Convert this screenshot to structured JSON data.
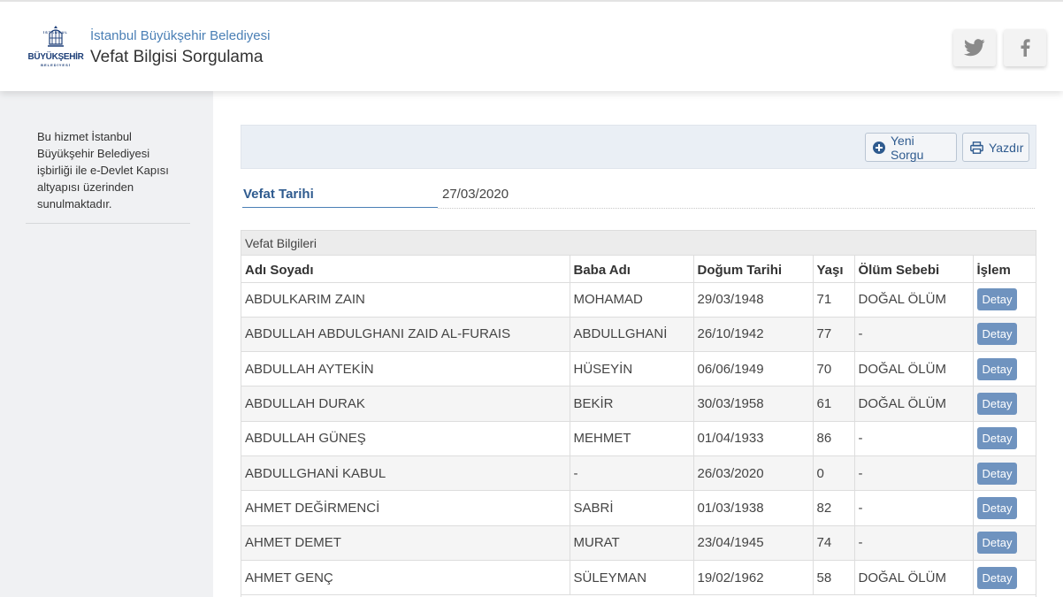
{
  "header": {
    "logo": {
      "top_text": "İSTANBUL",
      "main_text": "BÜYÜKŞEHİR",
      "sub_text": "BELEDİYESİ"
    },
    "organization": "İstanbul Büyükşehir Belediyesi",
    "title": "Vefat Bilgisi Sorgulama",
    "social": [
      {
        "icon": "twitter-icon"
      },
      {
        "icon": "facebook-icon"
      }
    ]
  },
  "sidebar": {
    "notice": "Bu hizmet İstanbul Büyükşehir Belediyesi işbirliği ile e-Devlet Kapısı altyapısı üzerinden sunulmaktadır."
  },
  "toolbar": {
    "new_query_label": "Yeni Sorgu",
    "new_query_icon": "plus-circle-icon",
    "print_label": "Yazdır",
    "print_icon": "printer-icon"
  },
  "filter": {
    "label": "Vefat Tarihi",
    "value": "27/03/2020"
  },
  "table": {
    "caption": "Vefat Bilgileri",
    "columns": [
      "Adı Soyadı",
      "Baba Adı",
      "Doğum Tarihi",
      "Yaşı",
      "Ölüm Sebebi",
      "İşlem"
    ],
    "action_label": "Detay",
    "rows": [
      {
        "name": "ABDULKARIM ZAIN",
        "father": "MOHAMAD",
        "birth": "29/03/1948",
        "age": "71",
        "cause": "DOĞAL ÖLÜM"
      },
      {
        "name": "ABDULLAH ABDULGHANI ZAID AL-FURAIS",
        "father": "ABDULLGHANİ",
        "birth": "26/10/1942",
        "age": "77",
        "cause": "-"
      },
      {
        "name": "ABDULLAH AYTEKİN",
        "father": "HÜSEYİN",
        "birth": "06/06/1949",
        "age": "70",
        "cause": "DOĞAL ÖLÜM"
      },
      {
        "name": "ABDULLAH DURAK",
        "father": "BEKİR",
        "birth": "30/03/1958",
        "age": "61",
        "cause": "DOĞAL ÖLÜM"
      },
      {
        "name": "ABDULLAH GÜNEŞ",
        "father": "MEHMET",
        "birth": "01/04/1933",
        "age": "86",
        "cause": "-"
      },
      {
        "name": "ABDULLGHANİ KABUL",
        "father": "-",
        "birth": "26/03/2020",
        "age": "0",
        "cause": "-"
      },
      {
        "name": "AHMET DEĞİRMENCİ",
        "father": "SABRİ",
        "birth": "01/03/1938",
        "age": "82",
        "cause": "-"
      },
      {
        "name": "AHMET DEMET",
        "father": "MURAT",
        "birth": "23/04/1945",
        "age": "74",
        "cause": "-"
      },
      {
        "name": "AHMET GENÇ",
        "father": "SÜLEYMAN",
        "birth": "19/02/1962",
        "age": "58",
        "cause": "DOĞAL ÖLÜM"
      }
    ]
  }
}
